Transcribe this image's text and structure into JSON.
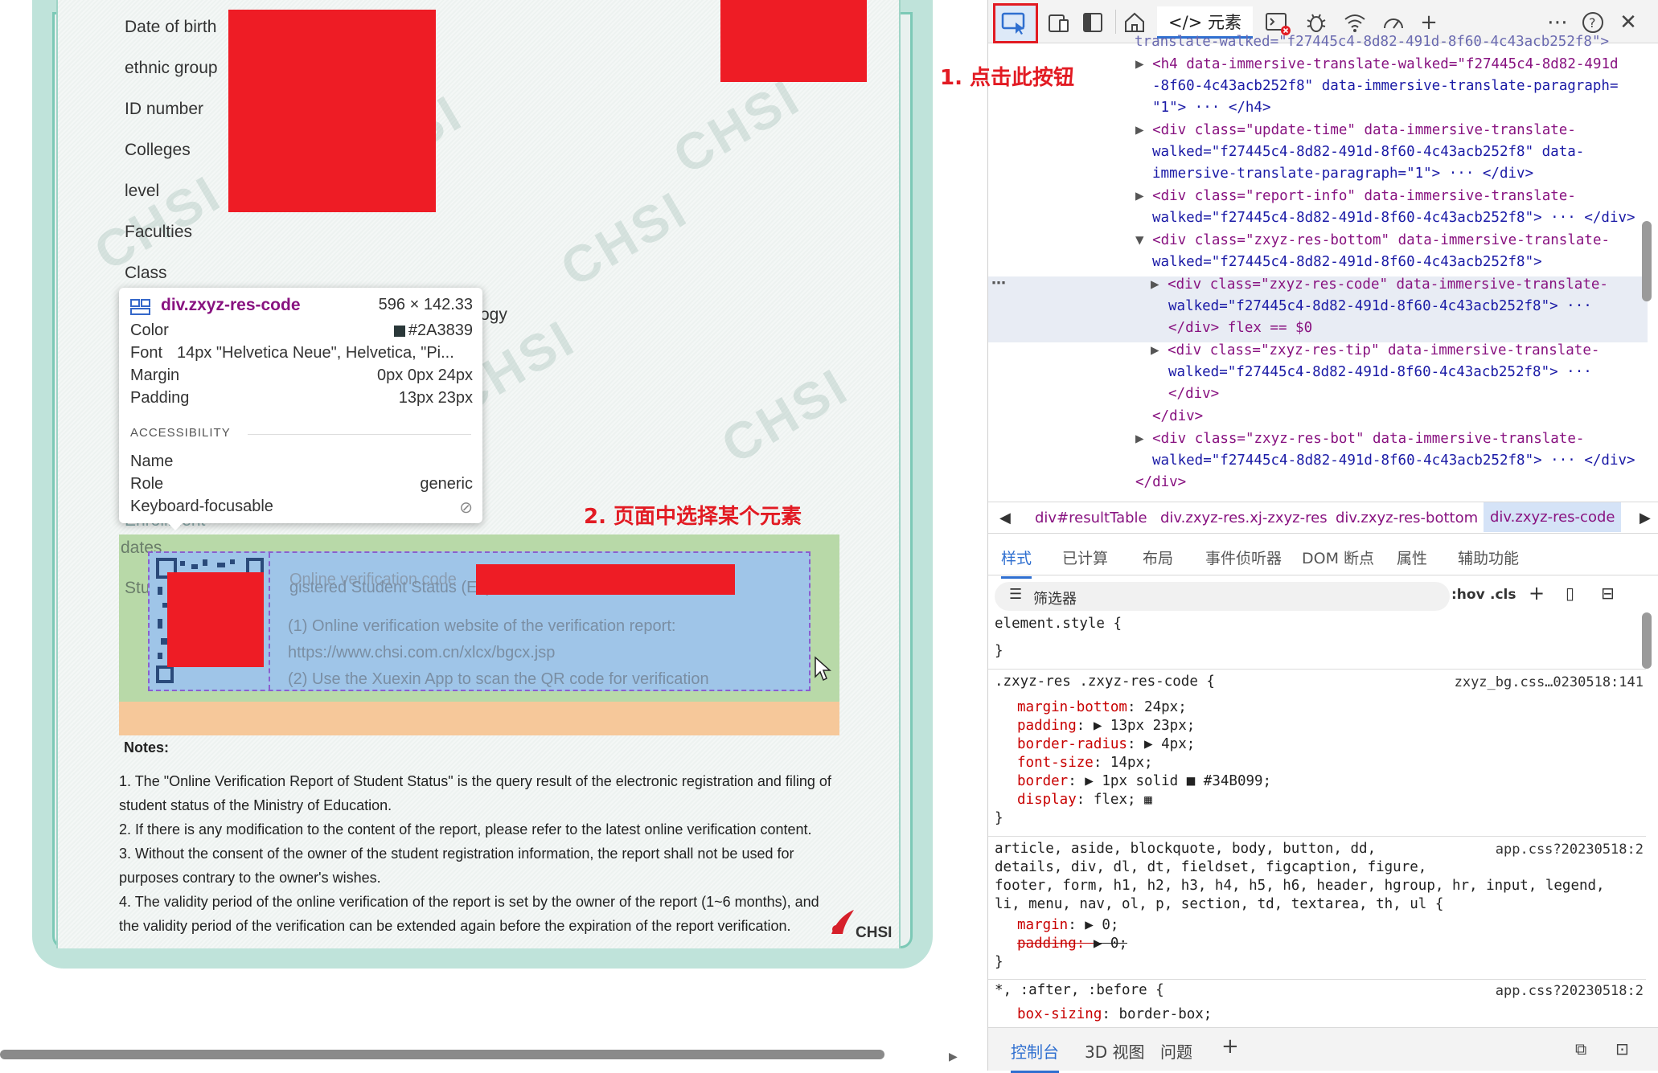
{
  "page": {
    "labels": [
      "Date of birth",
      "ethnic group",
      "ID number",
      "Colleges",
      "level",
      "Faculties",
      "Class"
    ],
    "partial_labels": {
      "ogy": "ogy",
      "enrollment": "Enrollment",
      "dates": "dates",
      "stu": "Stu"
    },
    "watermark": "CHSI",
    "logo_text": "CHSI",
    "tooltip": {
      "selector": "div.zxyz-res-code",
      "size": "596 × 142.33",
      "rows": [
        {
          "k": "Color",
          "v": "#2A3839"
        },
        {
          "k": "Font",
          "v": "14px \"Helvetica Neue\", Helvetica, \"Pi..."
        },
        {
          "k": "Margin",
          "v": "0px 0px 24px"
        },
        {
          "k": "Padding",
          "v": "13px 23px"
        }
      ],
      "accessibility_heading": "ACCESSIBILITY",
      "acc_rows": [
        {
          "k": "Name",
          "v": ""
        },
        {
          "k": "Role",
          "v": "generic"
        },
        {
          "k": "Keyboard-focusable",
          "v": "⊘"
        }
      ]
    },
    "code_box": {
      "overlap_title": "Online verification code",
      "overlap_student": "gistered Student Status (Expected Graduation Date:",
      "line1": "(1) Online verification website of the verification report:",
      "line2": "https://www.chsi.com.cn/xlcx/bgcx.jsp",
      "line3": "(2) Use the Xuexin App to scan the QR code for verification"
    },
    "notes": {
      "heading": "Notes:",
      "lines": [
        "1. The \"Online Verification Report of Student Status\" is the query result of the electronic registration and filing of",
        "student status of the Ministry of Education.",
        "2. If there is any modification to the content of the report, please refer to the latest online verification content.",
        "3. Without the consent of the owner of the student registration information, the report shall not be used for",
        "purposes contrary to the owner's wishes.",
        "4. The validity period of the online verification of the report is set by the owner of the report (1~6 months), and",
        "the validity period of the verification can be extended again before the expiration of the report verification."
      ]
    },
    "annotations": {
      "step1": "1. 点击此按钮",
      "step2": "2. 页面中选择某个元素"
    }
  },
  "devtools": {
    "toolbar": {
      "inspect_icon": "inspect-cursor-icon",
      "elements_tab": "</> 元素",
      "icons": [
        "device-toolbar-icon",
        "dock-side-icon",
        "home-icon",
        "console-error-icon",
        "bug-icon",
        "network-icon",
        "performance-icon",
        "plus-icon",
        "more-icon",
        "help-icon",
        "close-icon"
      ]
    },
    "dom": [
      {
        "text": "translate-walked=\"f27445c4-8d82-491d-8f60-4c43acb252f8\">"
      },
      {
        "tag": "h4",
        "text": "<h4 data-immersive-translate-walked=\"f27445c4-8d82-491d"
      },
      {
        "text": "-8f60-4c43acb252f8\" data-immersive-translate-paragraph="
      },
      {
        "text": "\"1\"> ··· </h4>"
      },
      {
        "text": "<div class=\"update-time\" data-immersive-translate-"
      },
      {
        "text": "walked=\"f27445c4-8d82-491d-8f60-4c43acb252f8\" data-"
      },
      {
        "text": "immersive-translate-paragraph=\"1\"> ··· </div>"
      },
      {
        "text": "<div class=\"report-info\" data-immersive-translate-"
      },
      {
        "text": "walked=\"f27445c4-8d82-491d-8f60-4c43acb252f8\"> ··· </div>"
      },
      {
        "text": "<div class=\"zxyz-res-bottom\" data-immersive-translate-"
      },
      {
        "text": "walked=\"f27445c4-8d82-491d-8f60-4c43acb252f8\">"
      },
      {
        "text": "<div class=\"zxyz-res-code\" data-immersive-translate-"
      },
      {
        "text": "walked=\"f27445c4-8d82-491d-8f60-4c43acb252f8\"> ···"
      },
      {
        "text": "</div>  flex  == $0"
      },
      {
        "text": "<div class=\"zxyz-res-tip\" data-immersive-translate-"
      },
      {
        "text": "walked=\"f27445c4-8d82-491d-8f60-4c43acb252f8\"> ···"
      },
      {
        "text": "</div>"
      },
      {
        "text": "</div>"
      },
      {
        "text": "<div class=\"zxyz-res-bot\" data-immersive-translate-"
      },
      {
        "text": "walked=\"f27445c4-8d82-491d-8f60-4c43acb252f8\"> ··· </div>"
      },
      {
        "text": "</div>"
      }
    ],
    "breadcrumbs": [
      "div#resultTable",
      "div.zxyz-res.xj-zxyz-res",
      "div.zxyz-res-bottom",
      "div.zxyz-res-code"
    ],
    "subtabs": [
      "样式",
      "已计算",
      "布局",
      "事件侦听器",
      "DOM 断点",
      "属性",
      "辅助功能"
    ],
    "filter_placeholder": "筛选器",
    "filter_tools": [
      ":hov",
      ".cls"
    ],
    "styles": {
      "element_style": "element.style {",
      "close": "}",
      "rule1_selector": ".zxyz-res .zxyz-res-code {",
      "rule1_source": "zxyz_bg.css…0230518:141",
      "rule1_props": [
        {
          "name": "margin-bottom",
          "value": "24px;"
        },
        {
          "name": "padding",
          "value": "▶ 13px 23px;"
        },
        {
          "name": "border-radius",
          "value": "▶ 4px;"
        },
        {
          "name": "font-size",
          "value": "14px;"
        },
        {
          "name": "border",
          "value": "▶ 1px solid ■ #34B099;"
        },
        {
          "name": "display",
          "value": "flex;"
        }
      ],
      "rule2_selector_lines": [
        "article, aside, blockquote, body, button, dd,",
        "details, div, dl, dt, fieldset, figcaption, figure,",
        "footer, form, h1, h2, h3, h4, h5, h6, header, hgroup, hr, input, legend,",
        "li, menu, nav, ol, p, section, td, textarea, th, ul {"
      ],
      "rule2_source": "app.css?20230518:2",
      "rule2_props": [
        {
          "name": "margin",
          "value": "▶ 0;",
          "struck": false
        },
        {
          "name": "padding",
          "value": "▶ 0;",
          "struck": true
        }
      ],
      "rule3_selector": "*, :after, :before {",
      "rule3_source": "app.css?20230518:2",
      "rule3_prop": {
        "name": "box-sizing",
        "value": "border-box;"
      }
    },
    "drawer_tabs": [
      "控制台",
      "3D 视图",
      "问题"
    ]
  }
}
